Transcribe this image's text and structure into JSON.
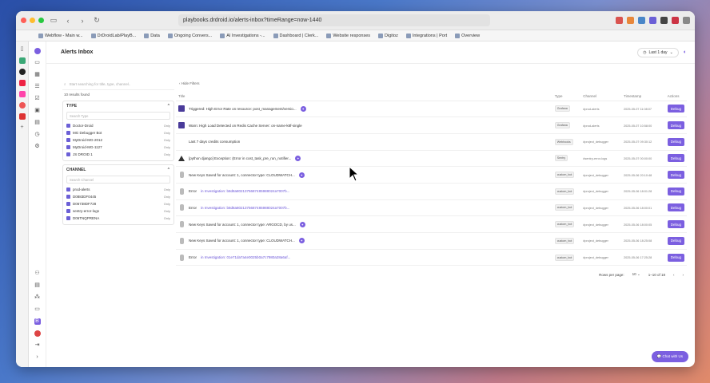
{
  "browser": {
    "url": "playbooks.drdroid.io/alerts-inbox?timeRange=now-1440",
    "bookmarks": [
      "Webflow - Main w...",
      "DrDroidLab/PlayB...",
      "Data",
      "Ongoing Convers...",
      "AI Investigations -...",
      "Dashboard | Clerk...",
      "Website responses",
      "Digitoz",
      "Integrations | Port",
      "Overview"
    ]
  },
  "header": {
    "title": "Alerts Inbox",
    "time_range": "Last 1 day"
  },
  "filters": {
    "search_placeholder": "Start searching for title, type, channel..",
    "results": "10 results found",
    "type": {
      "heading": "TYPE",
      "placeholder": "Search Type",
      "items": [
        "Doctor-Droid",
        "MG Debugger Bot",
        "MyDroid-MG-2012",
        "MyDroid-MG-1127",
        "JS DROID 1"
      ],
      "only": "Only"
    },
    "channel": {
      "heading": "CHANNEL",
      "placeholder": "Search Channel",
      "items": [
        "prod-alerts",
        "D0883DF0445",
        "D06738DF728",
        "sentry-error-logs",
        "D06TNQPRENA"
      ],
      "only": "Only"
    }
  },
  "main": {
    "hide_filters": "Hide Filters",
    "columns": [
      "Title",
      "Type",
      "Channel",
      "Timestamp",
      "Actions"
    ],
    "rows": [
      {
        "icon": "pd",
        "title": "Triggered: High Error Rate on resource: post_management/versio...",
        "link": "",
        "badge": true,
        "type": "Grafana",
        "channel": "#prod-alerts",
        "ts": "2025-05-07 11:08:07"
      },
      {
        "icon": "pd",
        "title": "Warn: High Load Detected on Redis Cache Server: on-name-k8f-single",
        "link": "",
        "badge": false,
        "type": "Grafana",
        "channel": "#prod-alerts",
        "ts": "2025-05-07 10:58:00"
      },
      {
        "icon": "blank",
        "title": "Last 7 days credits consumption",
        "link": "",
        "badge": false,
        "type": "Webhooks",
        "channel": "#project_debugger",
        "ts": "2025-05-07 09:30:12"
      },
      {
        "icon": "warn",
        "title": "[python django] Exception: (Error in cost_task_pre_run_notifier...",
        "link": "",
        "badge": true,
        "type": "Sentry",
        "channel": "#sentry-error-logs",
        "ts": "2025-05-07 00:00:00"
      },
      {
        "icon": "grey",
        "title": "New Keys Saved for account: 1, connector type: CLOUDWATCH...",
        "link": "",
        "badge": true,
        "type": "custom_bot",
        "channel": "#project_debugger",
        "ts": "2025-05-06 20:10:48"
      },
      {
        "icon": "grey",
        "title": "Error",
        "link": "in Investigation: b8d8a8021375687485988024a7007b...",
        "badge": false,
        "type": "custom_bot",
        "channel": "#project_debugger",
        "ts": "2025-05-06 18:01:28"
      },
      {
        "icon": "grey",
        "title": "Error",
        "link": "in Investigation: b8d8a8021375687485988024a7007b...",
        "badge": false,
        "type": "custom_bot",
        "channel": "#project_debugger",
        "ts": "2025-05-06 18:00:01"
      },
      {
        "icon": "grey",
        "title": "New Keys Saved for account: 1, connector type: ARGOCD, by us...",
        "link": "",
        "badge": true,
        "type": "custom_bot",
        "channel": "#project_debugger",
        "ts": "2025-05-06 18:00:05"
      },
      {
        "icon": "grey",
        "title": "New Keys Saved for account: 1, connector type: CLOUDWATCH...",
        "link": "",
        "badge": true,
        "type": "custom_bot",
        "channel": "#project_debugger",
        "ts": "2025-05-06 18:25:08"
      },
      {
        "icon": "grey",
        "title": "Error",
        "link": "in Investigation: 01e71da7a4e0025b0a7c7980a28a6af...",
        "badge": false,
        "type": "custom_bot",
        "channel": "#project_debugger",
        "ts": "2025-05-06 17:25:28"
      }
    ],
    "action_label": "Debug",
    "badge_text": "✦",
    "rows_per_page_label": "Rows per page:",
    "rows_per_page": "10",
    "range": "1–10 of 18"
  },
  "chat_label": "Chat with Us",
  "colors": {
    "accent": "#7b5fe0",
    "pagerduty": "#4a3b9a"
  }
}
